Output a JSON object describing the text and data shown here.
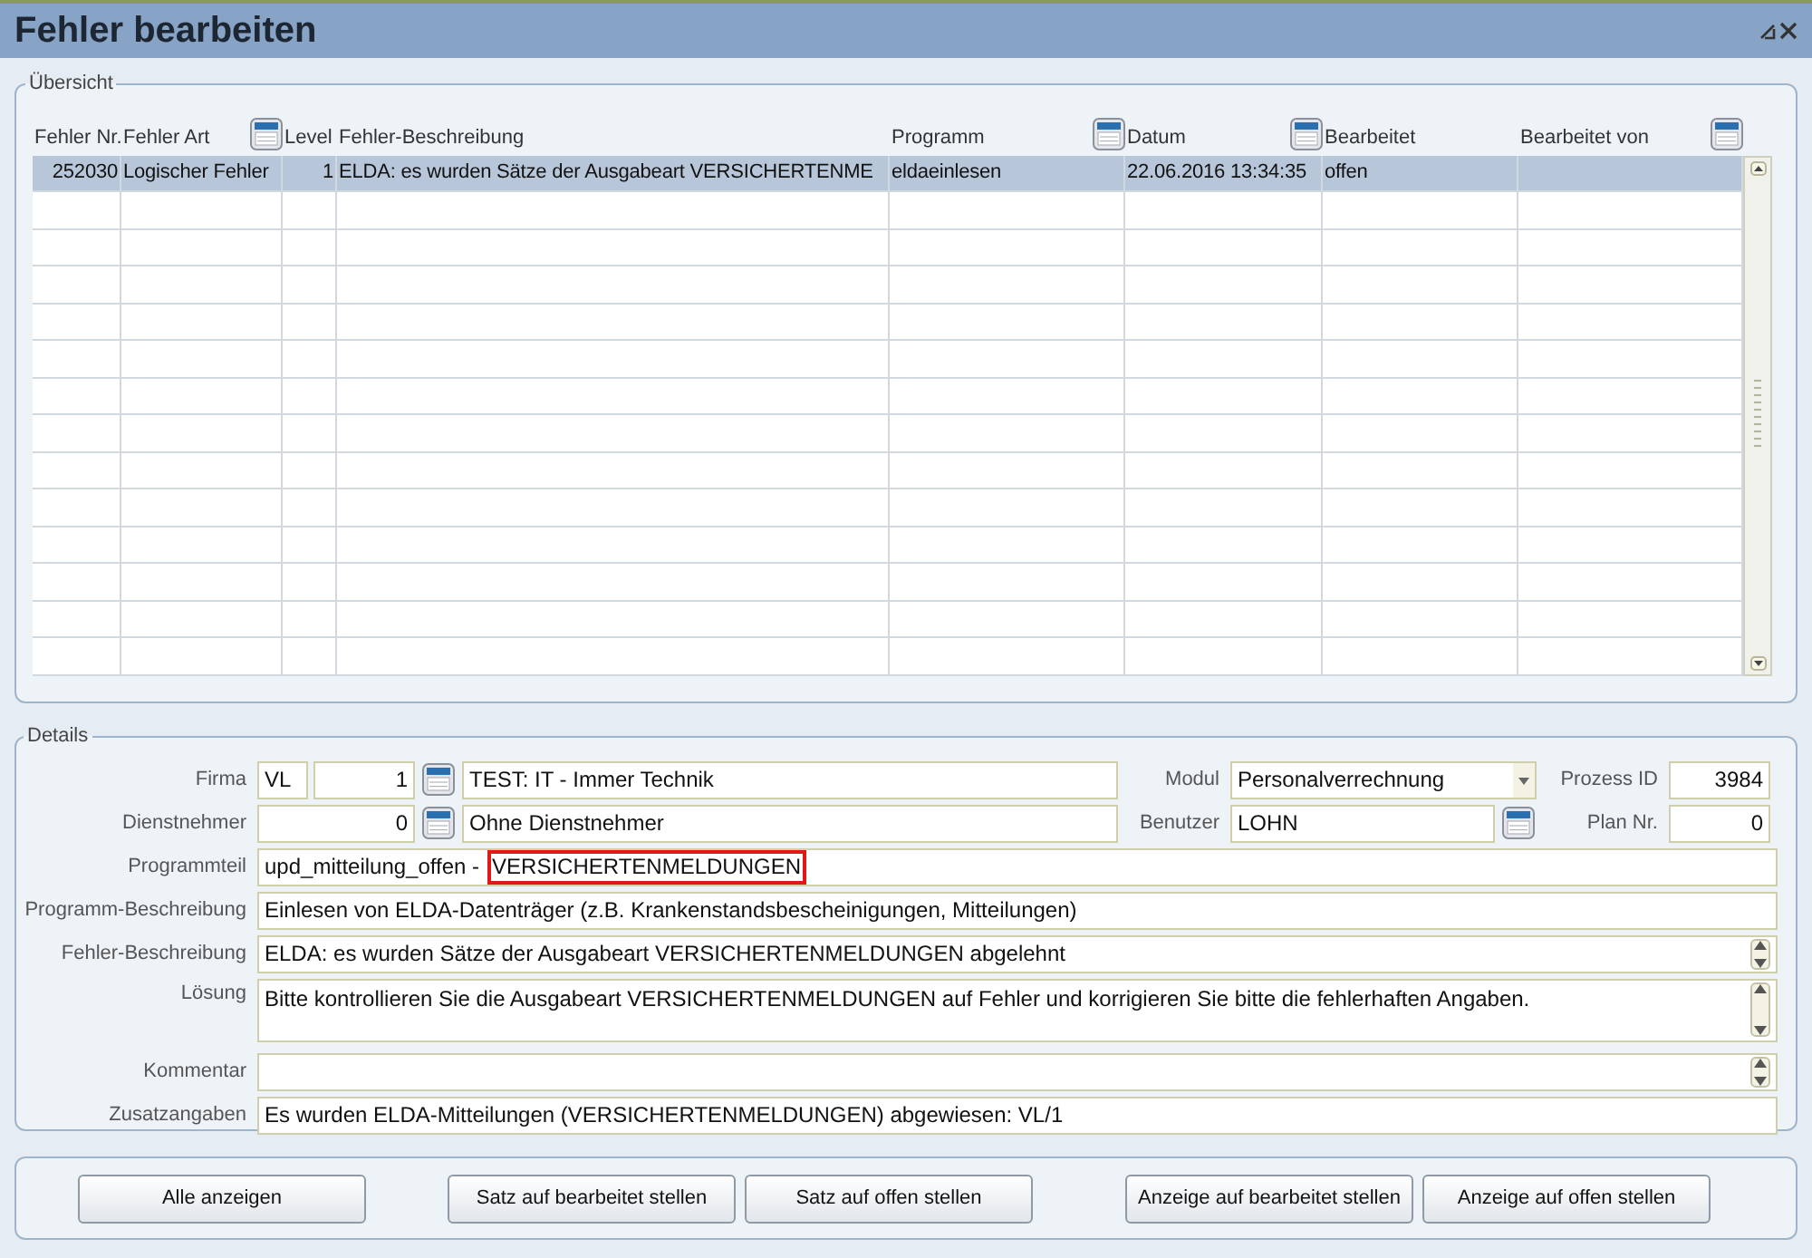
{
  "window": {
    "title": "Fehler bearbeiten"
  },
  "overview": {
    "legend": "Übersicht",
    "columns": [
      {
        "label": "Fehler Nr."
      },
      {
        "label": "Fehler Art",
        "picker": true
      },
      {
        "label": "Level"
      },
      {
        "label": "Fehler-Beschreibung"
      },
      {
        "label": "Programm",
        "picker": true
      },
      {
        "label": "Datum",
        "picker": true
      },
      {
        "label": "Bearbeitet"
      },
      {
        "label": "Bearbeitet von",
        "picker": true
      }
    ],
    "rows": [
      {
        "selected": true,
        "cells": [
          "252030",
          "Logischer Fehler",
          "1",
          "ELDA: es wurden Sätze der Ausgabeart VERSICHERTENME",
          "eldaeinlesen",
          "22.06.2016 13:34:35",
          "offen"
        ]
      }
    ]
  },
  "details": {
    "legend": "Details",
    "firma": {
      "label": "Firma",
      "code": "VL",
      "number": "1",
      "name": "TEST: IT - Immer Technik"
    },
    "modul": {
      "label": "Modul",
      "value": "Personalverrechnung"
    },
    "prozess_id": {
      "label": "Prozess ID",
      "value": "3984"
    },
    "dienstnehmer": {
      "label": "Dienstnehmer",
      "number": "0",
      "name": "Ohne Dienstnehmer"
    },
    "benutzer": {
      "label": "Benutzer",
      "value": "LOHN"
    },
    "plan_nr": {
      "label": "Plan Nr.",
      "value": "0"
    },
    "text_fields": [
      {
        "label": "Programmteil",
        "kind": "line",
        "value": "upd_mitteilung_offen -",
        "highlight": "VERSICHERTENMELDUNGEN"
      },
      {
        "label": "Programm-Beschreibung",
        "kind": "line",
        "value": "Einlesen von ELDA-Datenträger (z.B. Krankenstandsbescheinigungen, Mitteilungen)"
      },
      {
        "label": "Fehler-Beschreibung",
        "kind": "spin",
        "value": "ELDA: es wurden Sätze der Ausgabeart VERSICHERTENMELDUNGEN abgelehnt"
      },
      {
        "label": "Lösung",
        "kind": "memo",
        "value": "Bitte kontrollieren Sie die Ausgabeart VERSICHERTENMELDUNGEN auf Fehler und korrigieren Sie bitte die fehlerhaften Angaben."
      },
      {
        "label": "Kommentar",
        "kind": "spin"
      },
      {
        "label": "Zusatzangaben",
        "kind": "line",
        "value": "Es wurden ELDA-Mitteilungen (VERSICHERTENMELDUNGEN) abgewiesen: VL/1"
      }
    ]
  },
  "buttons": [
    "Alle anzeigen",
    "Satz auf bearbeitet stellen",
    "Satz auf offen stellen",
    "Anzeige auf bearbeitet stellen",
    "Anzeige auf offen stellen"
  ]
}
